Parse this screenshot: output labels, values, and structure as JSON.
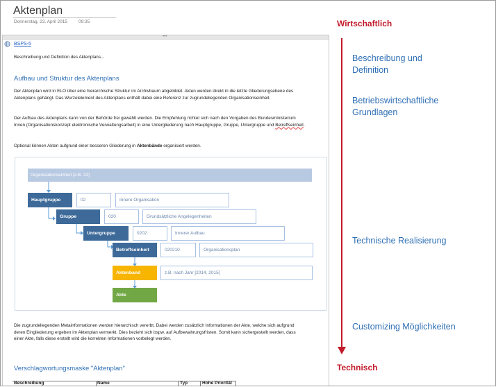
{
  "page": {
    "title": "Aktenplan",
    "date": "Donnerstag, 23. April 2015",
    "time": "09:35"
  },
  "content": {
    "link": "BSPS-5",
    "intro": "Beschreibung und Definition des Aktenplans...",
    "heading1": "Aufbau und Struktur des Aktenplans",
    "para1": "Der Aktenplan wird in ELO über eine hierarchische Struktur im Archivbaum abgebildet. Akten werden direkt in die letzte Gliederungsebene des Aktenplans gehängt. Das Wurzelelement des Aktenplans enthält dabei eine Referenz zur zugrundeliegenden Organisationseinheit.",
    "para2_main": "Der Aufbau des Aktenplans kann von der Behörde frei gewählt werden. Die Empfehlung richtet sich nach den Vorgaben des Bundesministerium Innen (Organisationskonzept elektronische Verwaltungsarbeit) in eine Untergliederung nach Hauptgruppe, Gruppe, Untergruppe und ",
    "para2_spell": "Betreffseinheit",
    "para2_end": ".",
    "para3_pre": "Optional können Akten aufgrund einer besseren Gliederung in ",
    "para3_bold": "Aktenbände",
    "para3_post": " organisiert werden.",
    "para4": "Die zugrundeliegenden Metainformationen werden hierarchisch vererbt. Dabei werden zusätzlich Informationen der Akte, welche sich aufgrund deren Eingliederung ergeben im Aktenplan vermerkt. Dies bezieht sich bspw. auf Aufbewahrungsfristen. Somit kann sichergestellt werden, dass einer Akte, falls diese erstellt wird die korrekten Informationen vorbelegt werden.",
    "heading2": "Verschlagwortungsmaske \"Aktenplan\"",
    "table_headers": [
      "Beschreibung",
      "Name",
      "Typ",
      "Hohe Priorität"
    ]
  },
  "diagram": {
    "org": "Organisationseinheit [z.B. 22]",
    "hauptgruppe": "Hauptgruppe",
    "hauptgruppe_code": "02",
    "hauptgruppe_desc": "Innere Organisation",
    "gruppe": "Gruppe",
    "gruppe_code": "020",
    "gruppe_desc": "Grundsätzliche Angelegenheiten",
    "untergruppe": "Untergruppe",
    "untergruppe_code": "0202",
    "untergruppe_desc": "Innerer Aufbau",
    "betreffseinheit": "Betreffseinheit",
    "betreffseinheit_code": "020210",
    "betreffseinheit_desc": "Organisationsplan",
    "aktenband": "Aktenband",
    "aktenband_desc": "z.B. nach Jahr [2014, 2015]",
    "akte": "Akte",
    "colors": {
      "blue": "#3d6a99",
      "light_blue": "#b8c9e2",
      "yellow": "#f7b500",
      "green": "#71a845"
    }
  },
  "annotation": {
    "top": "Wirtschaftlich",
    "bottom": "Technisch",
    "items": [
      "Beschreibung und Definition",
      "Betriebswirtschaftliche Grundlagen",
      "Technische Realisierung",
      "Customizing Möglichkeiten"
    ],
    "accent": "#c21b2b",
    "label_color": "#2f6fb5"
  }
}
